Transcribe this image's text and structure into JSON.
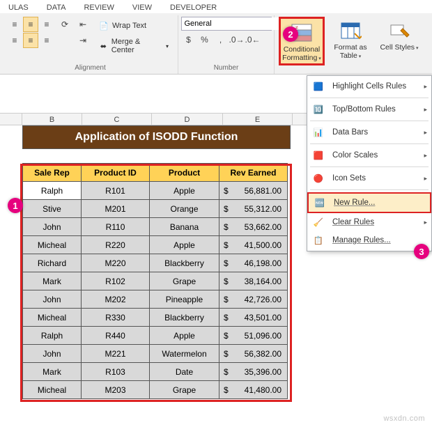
{
  "ribbon": {
    "tabs": [
      "ULAS",
      "DATA",
      "REVIEW",
      "VIEW",
      "DEVELOPER"
    ],
    "wrap": "Wrap Text",
    "merge": "Merge & Center",
    "alignment_label": "Alignment",
    "number_label": "Number",
    "format_value": "General",
    "cf": "Conditional Formatting",
    "fat": "Format as Table",
    "cs": "Cell Styles"
  },
  "menu": {
    "hcr": "Highlight Cells Rules",
    "tbr": "Top/Bottom Rules",
    "db": "Data Bars",
    "csc": "Color Scales",
    "is": "Icon Sets",
    "nr": "New Rule...",
    "cr": "Clear Rules",
    "mr": "Manage Rules..."
  },
  "columns": [
    "B",
    "C",
    "D",
    "E"
  ],
  "title": "Application of ISODD Function",
  "headers": [
    "Sale Rep",
    "Product ID",
    "Product",
    "Rev Earned"
  ],
  "rows": [
    {
      "rep": "Ralph",
      "pid": "R101",
      "prod": "Apple",
      "rev": "56,881.00"
    },
    {
      "rep": "Stive",
      "pid": "M201",
      "prod": "Orange",
      "rev": "55,312.00"
    },
    {
      "rep": "John",
      "pid": "R110",
      "prod": "Banana",
      "rev": "53,662.00"
    },
    {
      "rep": "Micheal",
      "pid": "R220",
      "prod": "Apple",
      "rev": "41,500.00"
    },
    {
      "rep": "Richard",
      "pid": "M220",
      "prod": "Blackberry",
      "rev": "46,198.00"
    },
    {
      "rep": "Mark",
      "pid": "R102",
      "prod": "Grape",
      "rev": "38,164.00"
    },
    {
      "rep": "John",
      "pid": "M202",
      "prod": "Pineapple",
      "rev": "42,726.00"
    },
    {
      "rep": "Micheal",
      "pid": "R330",
      "prod": "Blackberry",
      "rev": "43,501.00"
    },
    {
      "rep": "Ralph",
      "pid": "R440",
      "prod": "Apple",
      "rev": "51,096.00"
    },
    {
      "rep": "John",
      "pid": "M221",
      "prod": "Watermelon",
      "rev": "56,382.00"
    },
    {
      "rep": "Mark",
      "pid": "R103",
      "prod": "Date",
      "rev": "35,396.00"
    },
    {
      "rep": "Micheal",
      "pid": "M203",
      "prod": "Grape",
      "rev": "41,480.00"
    }
  ],
  "watermark": "wsxdn.com",
  "chart_data": {
    "type": "table",
    "title": "Application of ISODD Function",
    "columns": [
      "Sale Rep",
      "Product ID",
      "Product",
      "Rev Earned ($)"
    ],
    "rows": [
      [
        "Ralph",
        "R101",
        "Apple",
        56881.0
      ],
      [
        "Stive",
        "M201",
        "Orange",
        55312.0
      ],
      [
        "John",
        "R110",
        "Banana",
        53662.0
      ],
      [
        "Micheal",
        "R220",
        "Apple",
        41500.0
      ],
      [
        "Richard",
        "M220",
        "Blackberry",
        46198.0
      ],
      [
        "Mark",
        "R102",
        "Grape",
        38164.0
      ],
      [
        "John",
        "M202",
        "Pineapple",
        42726.0
      ],
      [
        "Micheal",
        "R330",
        "Blackberry",
        43501.0
      ],
      [
        "Ralph",
        "R440",
        "Apple",
        51096.0
      ],
      [
        "John",
        "M221",
        "Watermelon",
        56382.0
      ],
      [
        "Mark",
        "R103",
        "Date",
        35396.0
      ],
      [
        "Micheal",
        "M203",
        "Grape",
        41480.0
      ]
    ]
  }
}
